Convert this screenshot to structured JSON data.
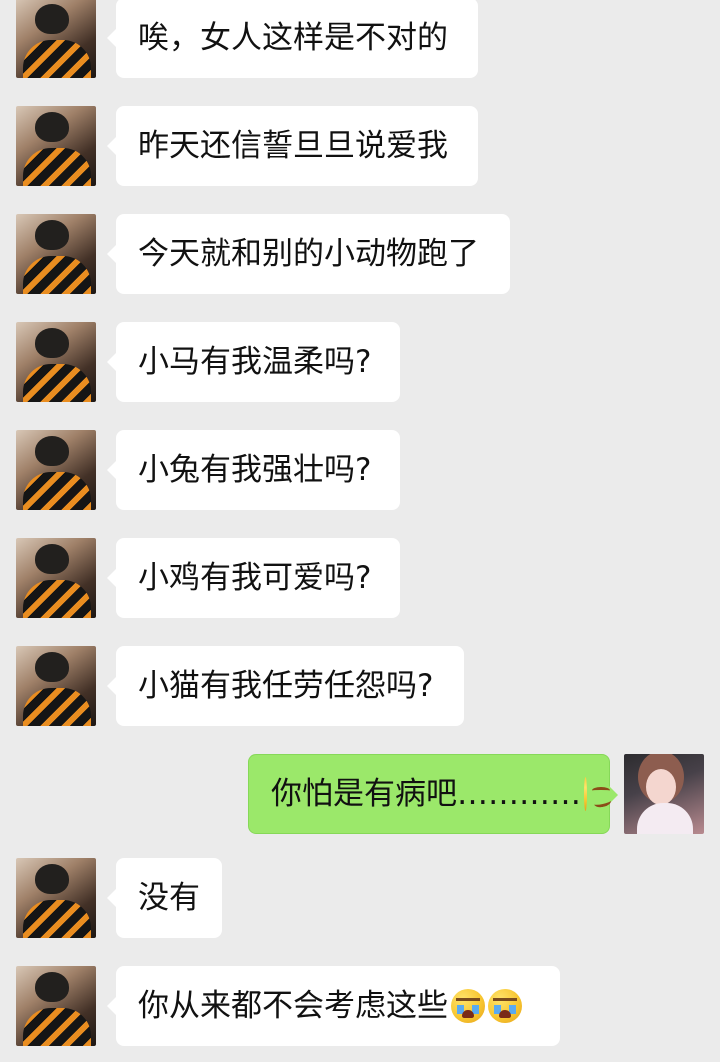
{
  "messages": [
    {
      "side": "left",
      "text": "唉，女人这样是不对的"
    },
    {
      "side": "left",
      "text": "昨天还信誓旦旦说爱我"
    },
    {
      "side": "left",
      "text": "今天就和别的小动物跑了"
    },
    {
      "side": "left",
      "text": "小马有我温柔吗?"
    },
    {
      "side": "left",
      "text": "小兔有我强壮吗?"
    },
    {
      "side": "left",
      "text": "小鸡有我可爱吗?"
    },
    {
      "side": "left",
      "text": "小猫有我任劳任怨吗?"
    },
    {
      "side": "right",
      "text": "你怕是有病吧…………",
      "emoji": "smirk-icon"
    },
    {
      "side": "left",
      "text": "没有"
    },
    {
      "side": "left",
      "text": "你从来都不会考虑这些",
      "emoji": [
        "cry-icon",
        "cry-icon"
      ]
    }
  ],
  "colors": {
    "background": "#ebebeb",
    "incoming_bubble": "#ffffff",
    "outgoing_bubble": "#9be86a",
    "text": "#111111"
  }
}
